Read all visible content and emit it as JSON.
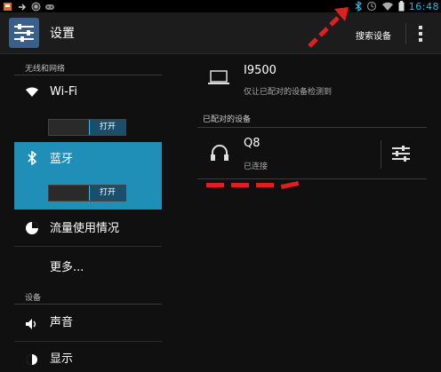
{
  "status_bar": {
    "time": "16:48",
    "left_icons": [
      "notification-icon",
      "usb-icon",
      "android-icon",
      "gamepad-icon"
    ],
    "right_icons": [
      "bluetooth-icon",
      "alarm-icon",
      "wifi-icon",
      "battery-icon"
    ]
  },
  "action_bar": {
    "title": "设置",
    "search_devices_label": "搜索设备",
    "overflow_icon": "overflow-menu-icon"
  },
  "left_panel": {
    "section_wireless": "无线和网络",
    "wifi": {
      "label": "Wi-Fi",
      "toggle_label": "打开"
    },
    "bluetooth": {
      "label": "蓝牙",
      "toggle_label": "打开"
    },
    "data_usage": {
      "label": "流量使用情况"
    },
    "more": {
      "label": "更多..."
    },
    "section_device": "设备",
    "sound": {
      "label": "声音"
    },
    "display": {
      "label": "显示"
    }
  },
  "right_panel": {
    "this_device": {
      "name": "I9500",
      "subtitle": "仅让已配对的设备检测到"
    },
    "paired_header": "已配对的设备",
    "paired_devices": [
      {
        "name": "Q8",
        "status": "已连接"
      }
    ]
  },
  "colors": {
    "accent": "#33b5e5",
    "selected_row": "#1f8fb8",
    "annotation": "#e02020"
  }
}
